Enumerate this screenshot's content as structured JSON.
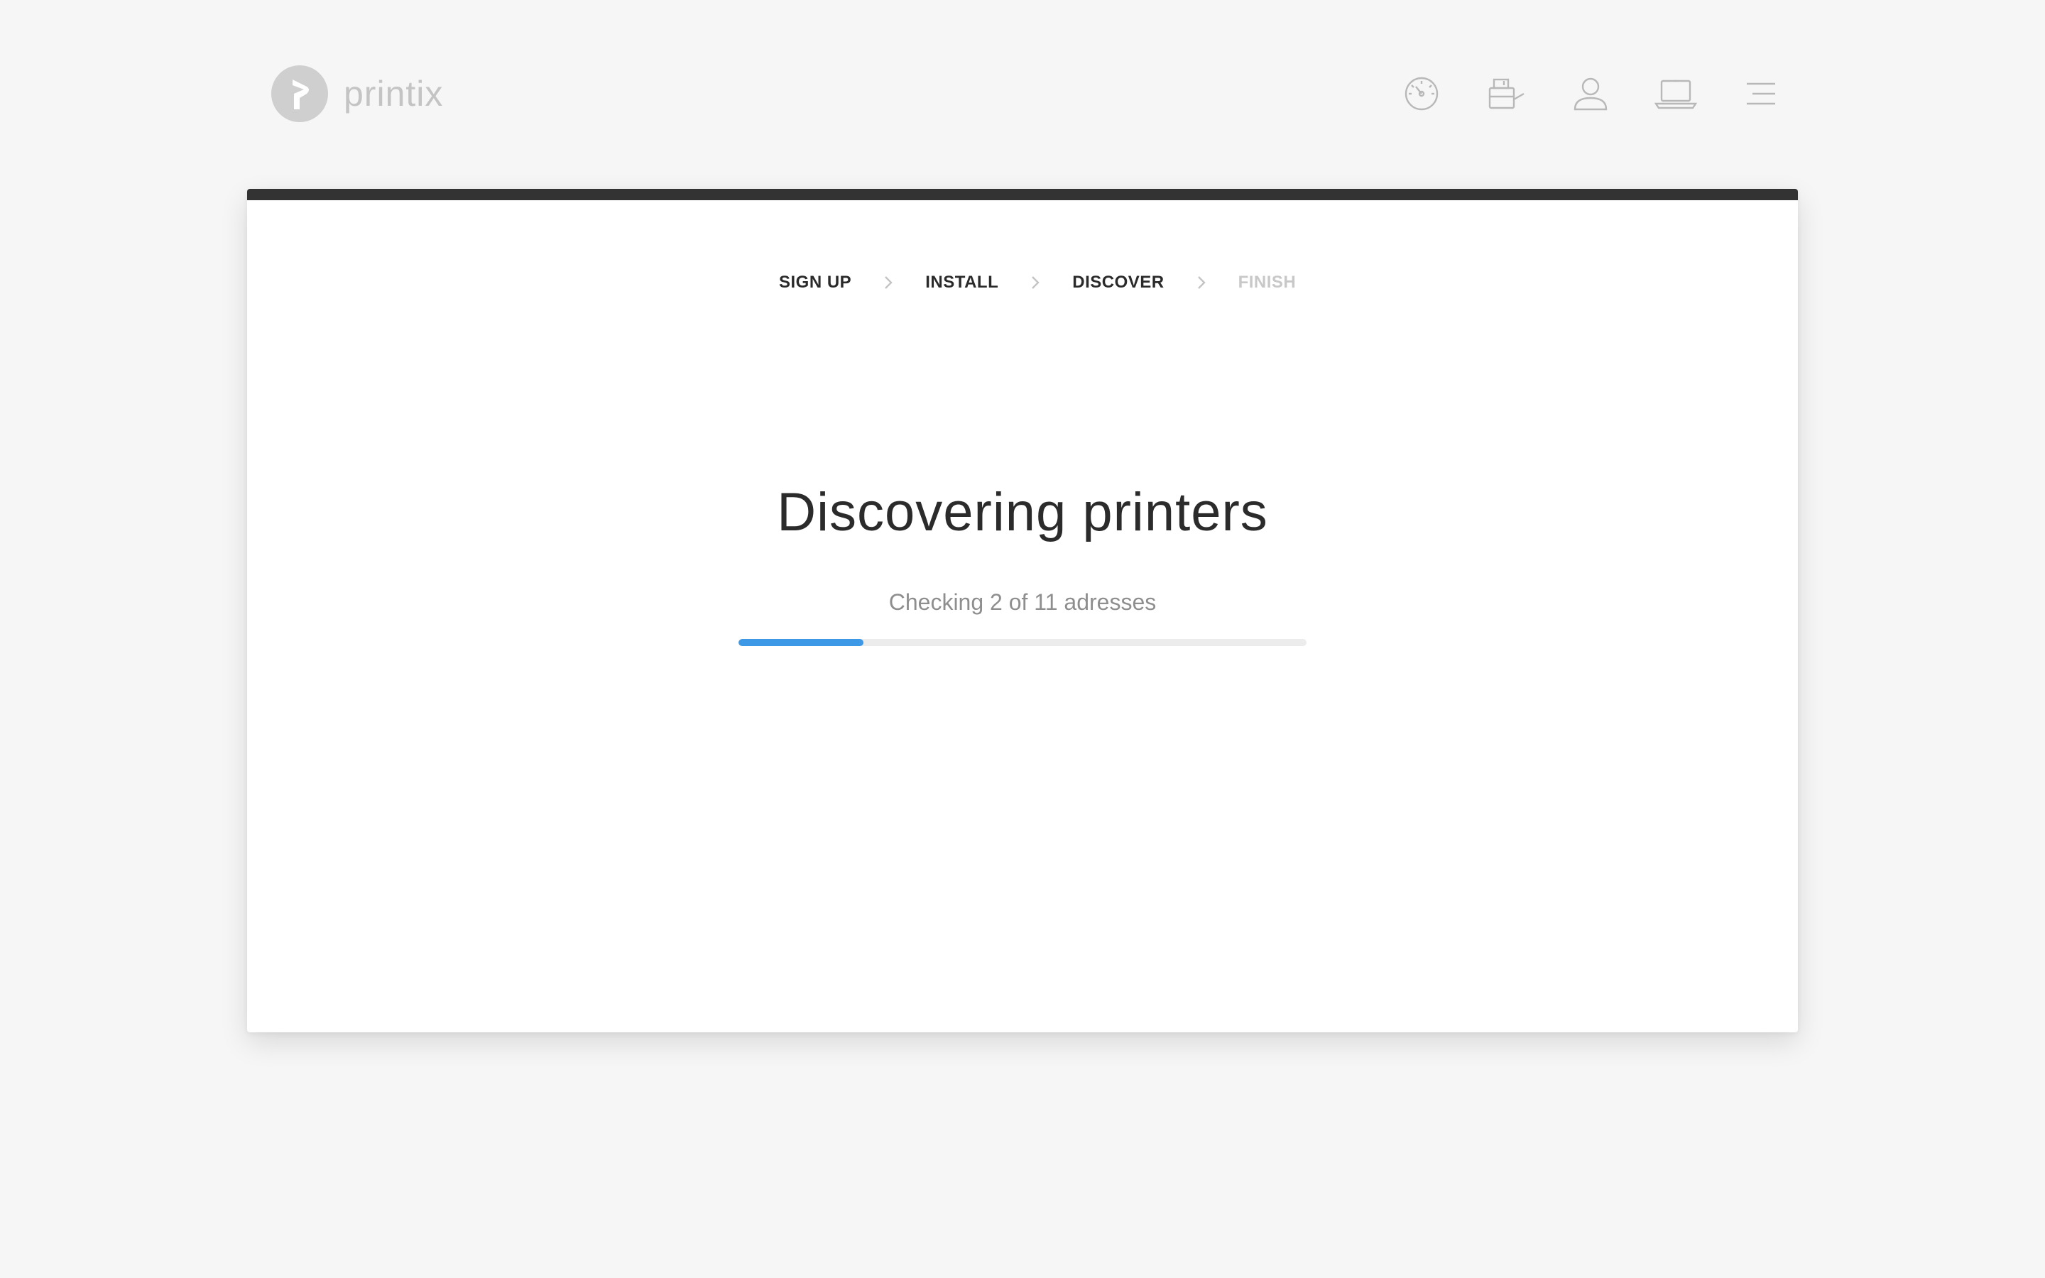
{
  "brand": {
    "name": "printix",
    "logo_icon": "printix-logo-icon"
  },
  "nav": {
    "items": [
      {
        "icon": "dashboard-gauge-icon"
      },
      {
        "icon": "printer-icon"
      },
      {
        "icon": "user-icon"
      },
      {
        "icon": "laptop-icon"
      },
      {
        "icon": "menu-icon"
      }
    ]
  },
  "wizard": {
    "steps": [
      {
        "label": "SIGN UP",
        "state": "done"
      },
      {
        "label": "INSTALL",
        "state": "done"
      },
      {
        "label": "DISCOVER",
        "state": "current"
      },
      {
        "label": "FINISH",
        "state": "pending"
      }
    ]
  },
  "main": {
    "title": "Discovering printers",
    "status": "Checking 2 of 11 adresses",
    "progress_fraction": 0.22
  },
  "colors": {
    "background": "#f6f6f6",
    "card_top_bar": "#333333",
    "progress_fill": "#3d98e6",
    "progress_track": "#ececec",
    "icon_gray": "#b8b8b8"
  }
}
